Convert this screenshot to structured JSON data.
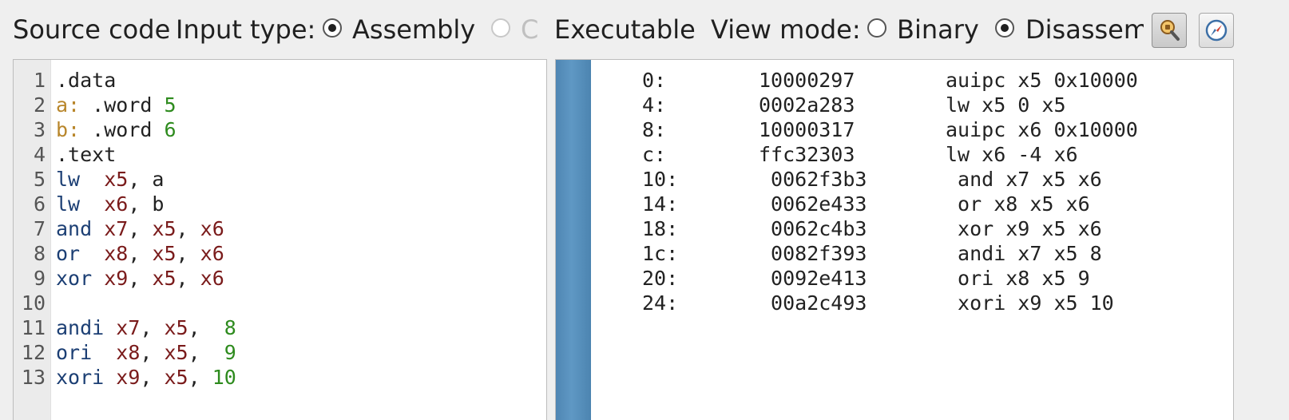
{
  "toolbar": {
    "source_label": "Source code",
    "input_type_label": "Input type:",
    "input_types": [
      {
        "label": "Assembly",
        "checked": true,
        "disabled": false
      },
      {
        "label": "C",
        "checked": false,
        "disabled": true
      },
      {
        "label": "Executable (",
        "checked": false,
        "disabled": false
      }
    ],
    "view_mode_label": "View mode:",
    "view_modes": [
      {
        "label": "Binary",
        "checked": false
      },
      {
        "label": "Disassembly",
        "checked": true
      }
    ],
    "icons": [
      "inspect-icon",
      "compass-icon"
    ]
  },
  "editor": {
    "lines": [
      {
        "n": "1",
        "tokens": [
          {
            "t": ".data",
            "c": "dir"
          }
        ]
      },
      {
        "n": "2",
        "tokens": [
          {
            "t": "a:",
            "c": "label"
          },
          {
            "t": " .word ",
            "c": "dir"
          },
          {
            "t": "5",
            "c": "num"
          }
        ]
      },
      {
        "n": "3",
        "tokens": [
          {
            "t": "b:",
            "c": "label"
          },
          {
            "t": " .word ",
            "c": "dir"
          },
          {
            "t": "6",
            "c": "num"
          }
        ]
      },
      {
        "n": "4",
        "tokens": [
          {
            "t": ".text",
            "c": "dir"
          }
        ]
      },
      {
        "n": "5",
        "tokens": [
          {
            "t": "lw",
            "c": "instr"
          },
          {
            "t": "  ",
            "c": "dir"
          },
          {
            "t": "x5",
            "c": "reg"
          },
          {
            "t": ", a",
            "c": "dir"
          }
        ]
      },
      {
        "n": "6",
        "tokens": [
          {
            "t": "lw",
            "c": "instr"
          },
          {
            "t": "  ",
            "c": "dir"
          },
          {
            "t": "x6",
            "c": "reg"
          },
          {
            "t": ", b",
            "c": "dir"
          }
        ]
      },
      {
        "n": "7",
        "tokens": [
          {
            "t": "and",
            "c": "instr"
          },
          {
            "t": " ",
            "c": "dir"
          },
          {
            "t": "x7",
            "c": "reg"
          },
          {
            "t": ", ",
            "c": "dir"
          },
          {
            "t": "x5",
            "c": "reg"
          },
          {
            "t": ", ",
            "c": "dir"
          },
          {
            "t": "x6",
            "c": "reg"
          }
        ]
      },
      {
        "n": "8",
        "tokens": [
          {
            "t": "or",
            "c": "instr"
          },
          {
            "t": "  ",
            "c": "dir"
          },
          {
            "t": "x8",
            "c": "reg"
          },
          {
            "t": ", ",
            "c": "dir"
          },
          {
            "t": "x5",
            "c": "reg"
          },
          {
            "t": ", ",
            "c": "dir"
          },
          {
            "t": "x6",
            "c": "reg"
          }
        ]
      },
      {
        "n": "9",
        "tokens": [
          {
            "t": "xor",
            "c": "instr"
          },
          {
            "t": " ",
            "c": "dir"
          },
          {
            "t": "x9",
            "c": "reg"
          },
          {
            "t": ", ",
            "c": "dir"
          },
          {
            "t": "x5",
            "c": "reg"
          },
          {
            "t": ", ",
            "c": "dir"
          },
          {
            "t": "x6",
            "c": "reg"
          }
        ]
      },
      {
        "n": "10",
        "tokens": []
      },
      {
        "n": "11",
        "tokens": [
          {
            "t": "andi",
            "c": "instr"
          },
          {
            "t": " ",
            "c": "dir"
          },
          {
            "t": "x7",
            "c": "reg"
          },
          {
            "t": ", ",
            "c": "dir"
          },
          {
            "t": "x5",
            "c": "reg"
          },
          {
            "t": ",  ",
            "c": "dir"
          },
          {
            "t": "8",
            "c": "num"
          }
        ]
      },
      {
        "n": "12",
        "tokens": [
          {
            "t": "ori",
            "c": "instr"
          },
          {
            "t": "  ",
            "c": "dir"
          },
          {
            "t": "x8",
            "c": "reg"
          },
          {
            "t": ", ",
            "c": "dir"
          },
          {
            "t": "x5",
            "c": "reg"
          },
          {
            "t": ",  ",
            "c": "dir"
          },
          {
            "t": "9",
            "c": "num"
          }
        ]
      },
      {
        "n": "13",
        "tokens": [
          {
            "t": "xori",
            "c": "instr"
          },
          {
            "t": " ",
            "c": "dir"
          },
          {
            "t": "x9",
            "c": "reg"
          },
          {
            "t": ", ",
            "c": "dir"
          },
          {
            "t": "x5",
            "c": "reg"
          },
          {
            "t": ", ",
            "c": "dir"
          },
          {
            "t": "10",
            "c": "num"
          }
        ]
      }
    ]
  },
  "disassembly": {
    "rows": [
      {
        "addr": "0:",
        "hex": "10000297",
        "asm": "auipc x5 0x10000"
      },
      {
        "addr": "4:",
        "hex": "0002a283",
        "asm": "lw x5 0 x5"
      },
      {
        "addr": "8:",
        "hex": "10000317",
        "asm": "auipc x6 0x10000"
      },
      {
        "addr": "c:",
        "hex": "ffc32303",
        "asm": "lw x6 -4 x6"
      },
      {
        "addr": "10:",
        "hex": " 0062f3b3",
        "asm": " and x7 x5 x6"
      },
      {
        "addr": "14:",
        "hex": " 0062e433",
        "asm": " or x8 x5 x6"
      },
      {
        "addr": "18:",
        "hex": " 0062c4b3",
        "asm": " xor x9 x5 x6"
      },
      {
        "addr": "1c:",
        "hex": " 0082f393",
        "asm": " andi x7 x5 8"
      },
      {
        "addr": "20:",
        "hex": " 0092e413",
        "asm": " ori x8 x5 9"
      },
      {
        "addr": "24:",
        "hex": " 00a2c493",
        "asm": " xori x9 x5 10"
      }
    ]
  },
  "colors": {
    "label": "#b8862b",
    "number": "#2e8b1e",
    "register": "#7a1b1b",
    "instruction": "#1c3f74",
    "scrollbar": "#5a93c0"
  }
}
